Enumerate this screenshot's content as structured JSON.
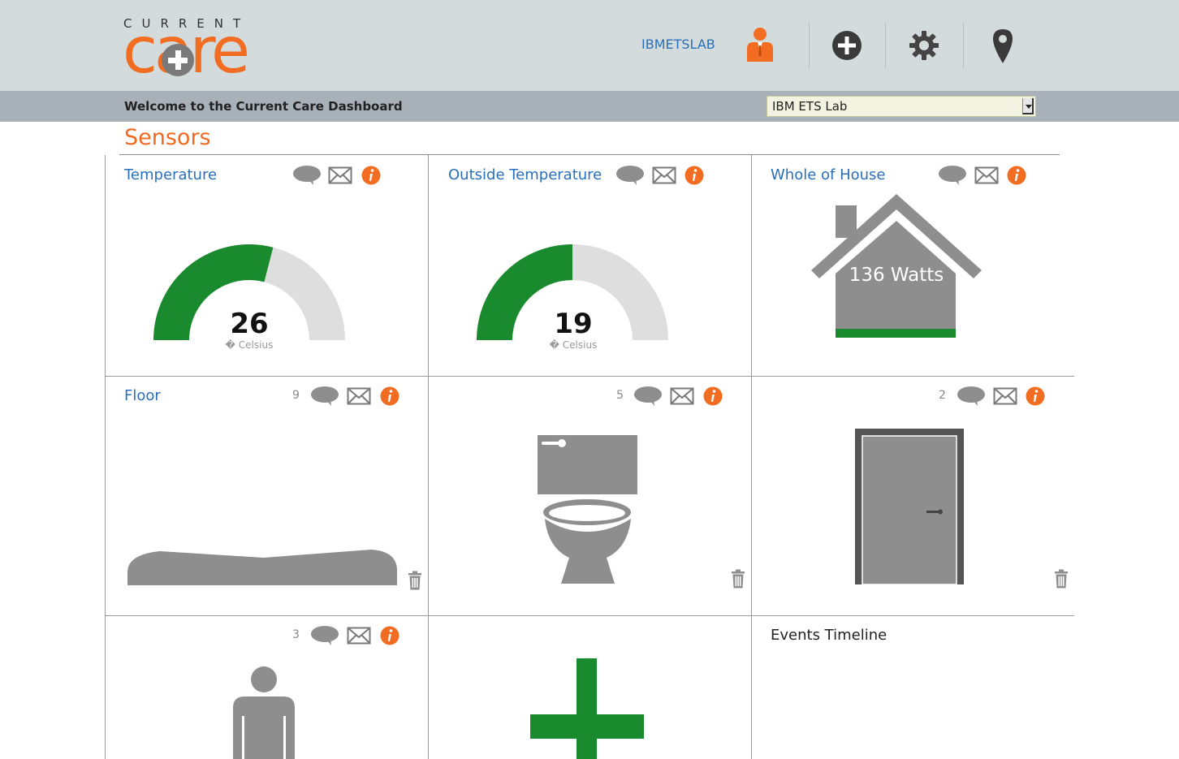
{
  "header": {
    "logo_top": "CURRENT",
    "logo_main": "care",
    "username": "IBMETSLAB"
  },
  "welcome": {
    "text": "Welcome to the Current Care Dashboard",
    "location_selected": "IBM ETS Lab"
  },
  "section": {
    "title": "Sensors"
  },
  "cards": {
    "temperature": {
      "title": "Temperature",
      "value": "26",
      "unit": "� Celsius",
      "gauge_fraction": 0.58
    },
    "outside_temperature": {
      "title": "Outside Temperature",
      "value": "19",
      "unit": "� Celsius",
      "gauge_fraction": 0.5
    },
    "whole_house": {
      "title": "Whole of House",
      "watts": "136 Watts"
    },
    "floor": {
      "title": "Floor",
      "count": "9"
    },
    "toilet": {
      "count": "5"
    },
    "door": {
      "count": "2"
    },
    "person": {
      "count": "3"
    },
    "timeline": {
      "title": "Events Timeline"
    }
  },
  "colors": {
    "accent_orange": "#f26d21",
    "link_blue": "#2a6fba",
    "gauge_green": "#1a8a2e",
    "icon_gray": "#8e8e8e"
  }
}
